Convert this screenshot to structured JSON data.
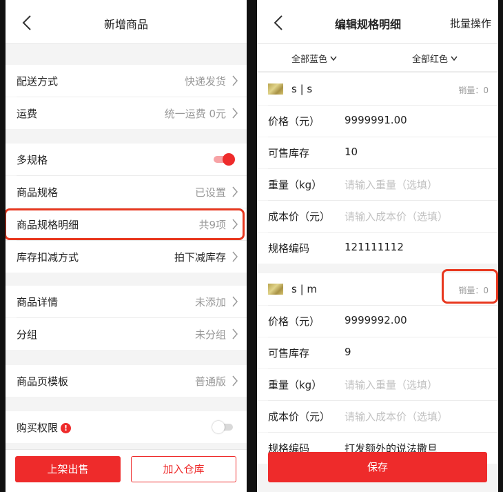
{
  "left": {
    "title": "新增商品",
    "rows": {
      "delivery": {
        "label": "配送方式",
        "value": "快递发货"
      },
      "freight": {
        "label": "运费",
        "value": "统一运费 0元"
      },
      "multi_spec": {
        "label": "多规格",
        "on": true
      },
      "spec": {
        "label": "商品规格",
        "value": "已设置"
      },
      "spec_detail": {
        "label": "商品规格明细",
        "value": "共9项"
      },
      "stock_mode": {
        "label": "库存扣减方式",
        "value": "拍下减库存"
      },
      "detail": {
        "label": "商品详情",
        "value": "未添加"
      },
      "group": {
        "label": "分组",
        "value": "未分组"
      },
      "template": {
        "label": "商品页模板",
        "value": "普通版"
      },
      "purchase_limit": {
        "label": "购买权限",
        "badge": "!",
        "on": false
      }
    },
    "buttons": {
      "publish": "上架出售",
      "warehouse": "加入仓库"
    }
  },
  "right": {
    "title": "编辑规格明细",
    "action": "批量操作",
    "filters": {
      "color_a": "全部蓝色",
      "color_b": "全部红色"
    },
    "labels": {
      "price": "价格（元）",
      "stock": "可售库存",
      "weight": "重量（kg）",
      "cost": "成本价（元）",
      "code": "规格编码"
    },
    "specs": [
      {
        "name": "s | s",
        "sales": "销量：0",
        "price": "9999991.00",
        "stock": "10",
        "weight_placeholder": "请输入重量（选填）",
        "cost_placeholder": "请输入成本价（选填）",
        "code": "121111112"
      },
      {
        "name": "s | m",
        "sales": "销量：0",
        "price": "9999992.00",
        "stock": "9",
        "weight_placeholder": "请输入重量（选填）",
        "cost_placeholder": "请输入成本价（选填）",
        "code": "打发额外的说法撒旦"
      }
    ],
    "save": "保存"
  },
  "colors": {
    "accent": "#ee2b2b",
    "highlight": "#e8371e"
  }
}
